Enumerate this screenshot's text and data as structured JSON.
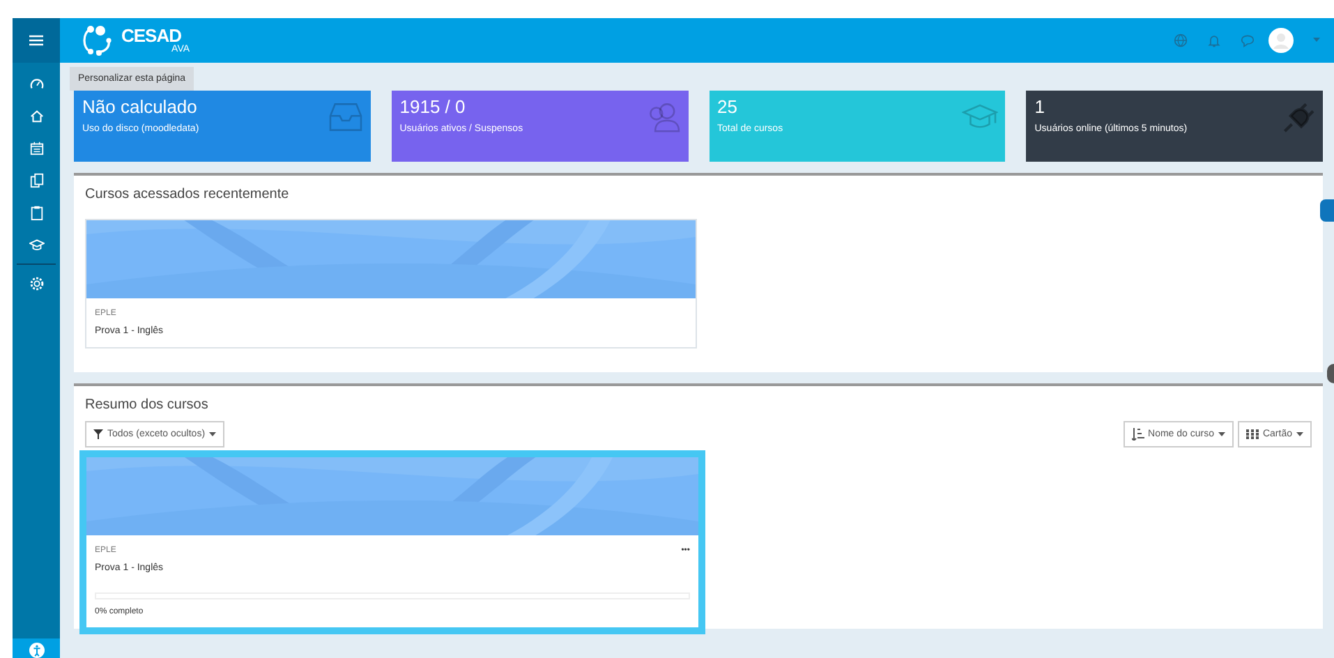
{
  "header": {
    "logo": "CESAD",
    "logo_sub": "AVA"
  },
  "customize_button": "Personalizar esta página",
  "stats": [
    {
      "value": "Não calculado",
      "label": "Uso do disco (moodledata)",
      "color": "#2089e3",
      "kind": "inbox"
    },
    {
      "value": "1915 / 0",
      "label": "Usuários ativos / Suspensos",
      "color": "#7763ee",
      "kind": "users"
    },
    {
      "value": "25",
      "label": "Total de cursos",
      "color": "#24c6d9",
      "kind": "cap"
    },
    {
      "value": "1",
      "label": "Usuários online (últimos 5 minutos)",
      "color": "#323c48",
      "kind": "plug"
    }
  ],
  "recent": {
    "title": "Cursos acessados recentemente",
    "courses": [
      {
        "category": "EPLE",
        "name": "Prova 1 - Inglês"
      }
    ]
  },
  "overview": {
    "title": "Resumo dos cursos",
    "filter": "Todos (exceto ocultos)",
    "sort": "Nome do curso",
    "view": "Cartão",
    "courses": [
      {
        "category": "EPLE",
        "name": "Prova 1 - Inglês",
        "menu": "•••",
        "level": 0,
        "progress": "0% completo",
        "highlighted": true
      }
    ]
  }
}
